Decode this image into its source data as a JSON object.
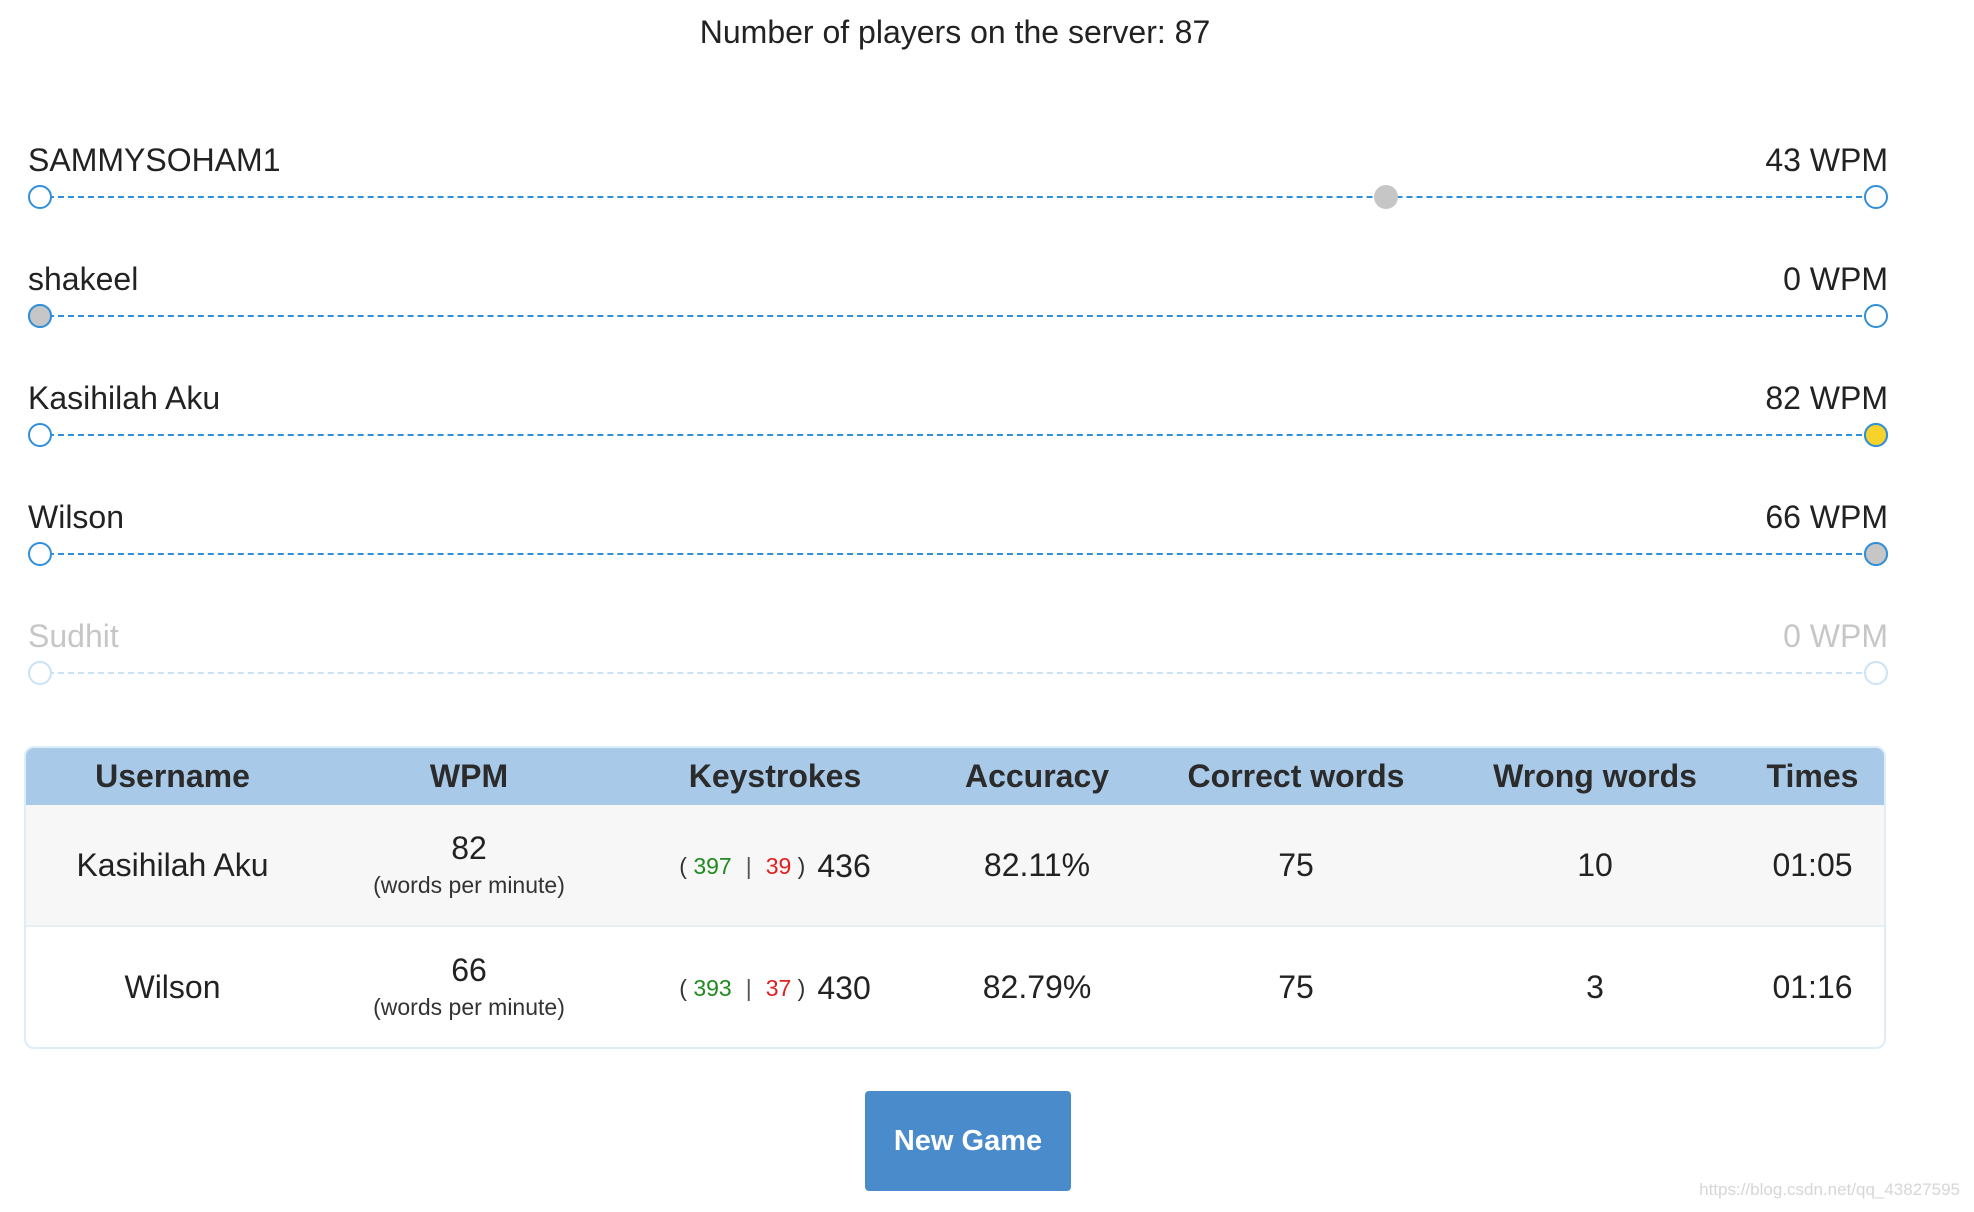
{
  "header": {
    "server_count_label": "Number of players on the server: 87"
  },
  "colors": {
    "track_blue": "#2f8fd8",
    "table_header": "#a8c9e8",
    "button_blue": "#4a8bcb",
    "correct_green": "#1f8a1f",
    "wrong_red": "#e02020",
    "gold_dot": "#f7d22a",
    "gray_dot": "#c6c6c6"
  },
  "players": [
    {
      "name": "SAMMYSOHAM1",
      "wpm_label": "43 WPM",
      "progress": 0.733,
      "dot": "gray",
      "active": true
    },
    {
      "name": "shakeel",
      "wpm_label": "0 WPM",
      "progress": 0.0,
      "dot": "gray",
      "active": true
    },
    {
      "name": "Kasihilah Aku",
      "wpm_label": "82 WPM",
      "progress": 1.0,
      "dot": "gold",
      "active": true
    },
    {
      "name": "Wilson",
      "wpm_label": "66 WPM",
      "progress": 1.0,
      "dot": "gray",
      "active": true
    },
    {
      "name": "Sudhit",
      "wpm_label": "0 WPM",
      "progress": 0.0,
      "dot": "none",
      "active": false
    }
  ],
  "results": {
    "columns": [
      "Username",
      "WPM",
      "Keystrokes",
      "Accuracy",
      "Correct words",
      "Wrong words",
      "Times"
    ],
    "rows": [
      {
        "username": "Kasihilah Aku",
        "wpm": "82",
        "wpm_sub": "(words per minute)",
        "keystrokes_open": "(",
        "keystrokes_correct": "397",
        "keystrokes_sep": "|",
        "keystrokes_wrong": "39",
        "keystrokes_close": ")",
        "keystrokes_total": "436",
        "accuracy": "82.11%",
        "correct_words": "75",
        "wrong_words": "10",
        "time": "01:05"
      },
      {
        "username": "Wilson",
        "wpm": "66",
        "wpm_sub": "(words per minute)",
        "keystrokes_open": "(",
        "keystrokes_correct": "393",
        "keystrokes_sep": "|",
        "keystrokes_wrong": "37",
        "keystrokes_close": ")",
        "keystrokes_total": "430",
        "accuracy": "82.79%",
        "correct_words": "75",
        "wrong_words": "3",
        "time": "01:16"
      }
    ]
  },
  "actions": {
    "new_game_label": "New Game"
  },
  "watermark": "https://blog.csdn.net/qq_43827595"
}
